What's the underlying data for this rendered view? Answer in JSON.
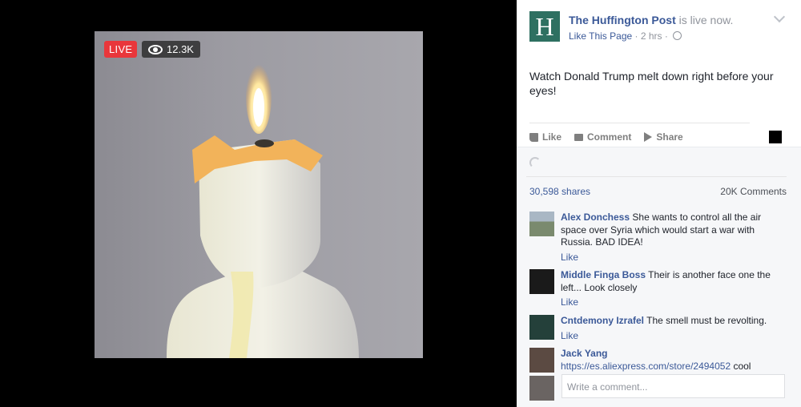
{
  "video": {
    "live_label": "LIVE",
    "views": "12.3K"
  },
  "post": {
    "page_name": "The Huffington Post",
    "status_suffix": " is live now.",
    "logo_letter": "H",
    "like_page": "Like This Page",
    "time": " · 2 hrs · ",
    "text": "Watch Donald Trump melt down right before your eyes!"
  },
  "actions": {
    "like": "Like",
    "comment": "Comment",
    "share": "Share"
  },
  "stats": {
    "shares": "30,598 shares",
    "comments": "20K Comments"
  },
  "comments": [
    {
      "name": "Alex Donchess",
      "text": "She wants to control all the air space over Syria which would start a war with Russia. BAD IDEA!",
      "like": "Like"
    },
    {
      "name": "Middle Finga Boss",
      "text": "Their is another face one the left... Look closely",
      "like": "Like"
    },
    {
      "name": "Cntdemony Izrafel",
      "text": "The smell must be revolting.",
      "like": "Like"
    },
    {
      "name": "Jack Yang",
      "link": "https://es.aliexpress.com/store/2494052",
      "text": " cool"
    }
  ],
  "composer": {
    "placeholder": "Write a comment..."
  },
  "colors": {
    "brand_blue": "#3b5998",
    "live_red": "#e9373b",
    "huffpost_green": "#2e7061"
  }
}
